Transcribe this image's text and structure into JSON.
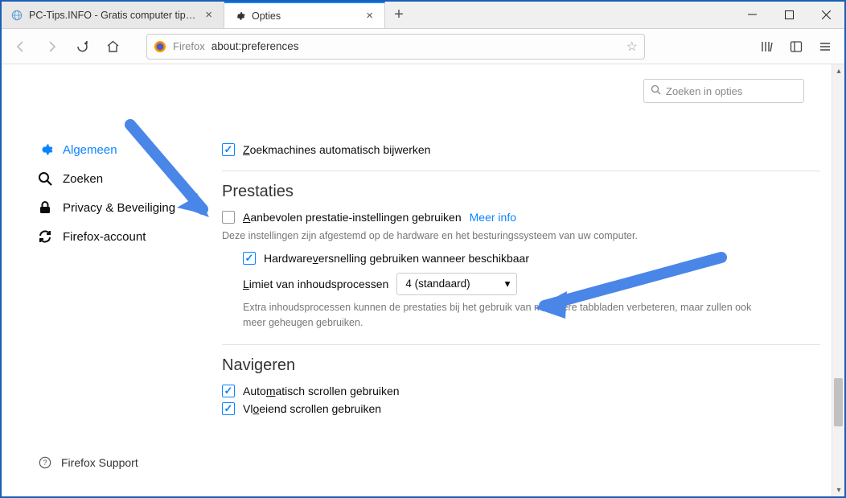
{
  "window": {
    "tabs": [
      {
        "title": "PC-Tips.INFO - Gratis computer tip…",
        "favicon": "globe"
      },
      {
        "title": "Opties",
        "favicon": "gear"
      }
    ],
    "url_brand": "Firefox",
    "url": "about:preferences"
  },
  "search": {
    "placeholder": "Zoeken in opties"
  },
  "sidebar": {
    "items": [
      {
        "label": "Algemeen",
        "icon": "gear"
      },
      {
        "label": "Zoeken",
        "icon": "search"
      },
      {
        "label": "Privacy & Beveiliging",
        "icon": "lock"
      },
      {
        "label": "Firefox-account",
        "icon": "sync"
      }
    ],
    "support": "Firefox Support"
  },
  "sections": {
    "updates": {
      "auto_update": "Zoekmachines automatisch bijwerken"
    },
    "prestaties": {
      "title": "Prestaties",
      "use_recommended": "Aanbevolen prestatie-instellingen gebruiken",
      "more_info": "Meer info",
      "desc": "Deze instellingen zijn afgestemd op de hardware en het besturingssysteem van uw computer.",
      "hw_accel": "Hardwareversnelling gebruiken wanneer beschikbaar",
      "limit_label": "Limiet van inhoudsprocessen",
      "limit_value": "4 (standaard)",
      "limit_desc": "Extra inhoudsprocessen kunnen de prestaties bij het gebruik van meerdere tabbladen verbeteren, maar zullen ook meer geheugen gebruiken."
    },
    "navigeren": {
      "title": "Navigeren",
      "auto_scroll": "Automatisch scrollen gebruiken",
      "smooth_scroll": "Vloeiend scrollen gebruiken"
    }
  }
}
